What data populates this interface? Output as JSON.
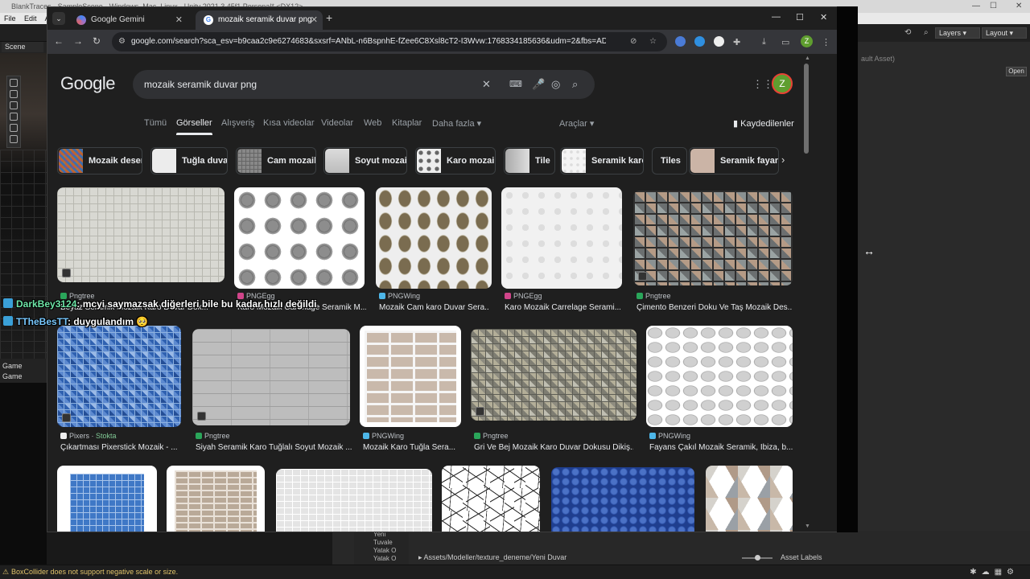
{
  "unity": {
    "title_text": "BlankTraces - SampleScene - Windows, Mac, Linux - Unity 2021.3.45f1 Personal* <DX12>",
    "menu": [
      "File",
      "Edit",
      "As"
    ],
    "scene_tab": "Scene",
    "game_tab": "Game",
    "game_dropdown": "Game",
    "right_layers": "Layers",
    "right_layout": "Layout",
    "asset_label": "ault Asset)",
    "open_button": "Open",
    "project_tree": [
      "Yeni",
      "Tuvale",
      "Yatak O",
      "Yatak O"
    ],
    "breadcrumb": "Assets/Modeller/texture_deneme/Yeni Duvar",
    "asset_labels": "Asset Labels",
    "status_warning": "BoxCollider does not support negative scale or size."
  },
  "chrome": {
    "tabs": [
      {
        "label": "Google Gemini",
        "active": false
      },
      {
        "label": "mozaik seramik duvar png - Go",
        "active": true
      }
    ],
    "url": "google.com/search?sca_esv=b9caa2c9e6274683&sxsrf=ANbL-n6BspnhE-fZee6C8Xsl8cT2-I3Wvw:1768334185636&udm=2&fbs=ADc_l-Yk7dC9rTocj...",
    "profile_initial": "Z"
  },
  "google": {
    "logo": "Google",
    "query": "mozaik seramik duvar png",
    "profile_initial": "Z",
    "tabs": [
      "Tümü",
      "Görseller",
      "Alışveriş",
      "Kısa videolar",
      "Videolar",
      "Web",
      "Kitaplar",
      "Daha fazla"
    ],
    "active_tab": "Görseller",
    "tools": "Araçlar",
    "saved": "Kaydedilenler",
    "chips": [
      "Mozaik desen",
      "Tuğla duvar",
      "Cam mozaik",
      "Soyut mozaik",
      "Karo mozaik",
      "Tile",
      "Seramik karo",
      "Tiles",
      "Seramik fayans"
    ],
    "results_row1": [
      {
        "source": "Pngtree",
        "caption": "Beyaz Seramik Mozaik Karo Duvar Dok..."
      },
      {
        "source": "PNGEgg",
        "caption": "Karo Mozaik Carrelage Seramik M..."
      },
      {
        "source": "PNGWing",
        "caption": "Mozaik Cam karo Duvar Sera..."
      },
      {
        "source": "PNGEgg",
        "caption": "Karo Mozaik Carrelage Serami..."
      },
      {
        "source": "Pngtree",
        "caption": "Çimento Benzeri Doku Ve Taş Mozaik Des..."
      }
    ],
    "results_row2": [
      {
        "source": "Pixers",
        "source_sub": "Stokta",
        "caption": "Çıkartması Pixerstick Mozaik - ..."
      },
      {
        "source": "Pngtree",
        "caption": "Siyah Seramik Karo Tuğlalı Soyut Mozaik ..."
      },
      {
        "source": "PNGWing",
        "caption": "Mozaik Karo Tuğla Sera..."
      },
      {
        "source": "Pngtree",
        "caption": "Gri Ve Bej Mozaik Karo Duvar Dokusu Dikiş..."
      },
      {
        "source": "PNGWing",
        "caption": "Fayans Çakıl Mozaik Seramik, Ibiza, b..."
      }
    ]
  },
  "chat": [
    {
      "user": "DarkBey3124",
      "message": ": mcyi saymazsak diğerleri bile bu kadar hızlı değildi"
    },
    {
      "user": "TTheBesTT",
      "message": ": duygulandım 🥺"
    }
  ]
}
